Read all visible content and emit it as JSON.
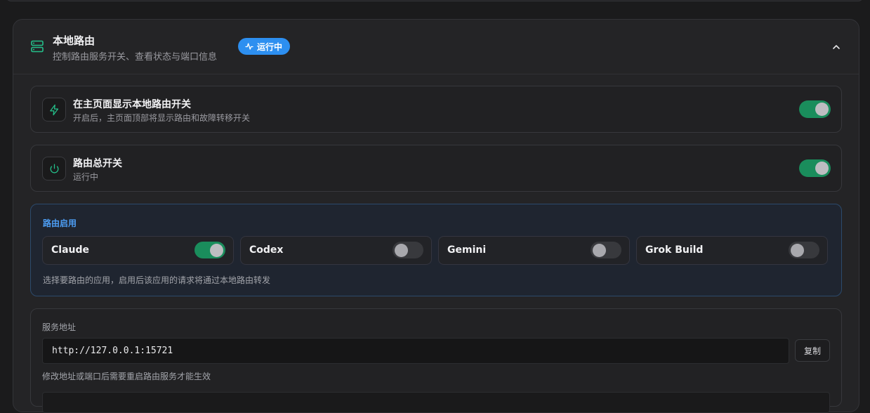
{
  "section": {
    "title": "本地路由",
    "subtitle": "控制路由服务开关、查看状态与端口信息",
    "status_badge": "运行中",
    "collapse_icon": "chevron-up-icon",
    "header_icon": "server-icon"
  },
  "show_on_main": {
    "title": "在主页面显示本地路由开关",
    "subtitle": "开启后，主页面顶部将显示路由和故障转移开关",
    "icon": "lightning-icon",
    "enabled": true
  },
  "master_switch": {
    "title": "路由总开关",
    "subtitle": "运行中",
    "icon": "power-icon",
    "enabled": true
  },
  "routing": {
    "label": "路由启用",
    "apps": [
      {
        "name": "Claude",
        "enabled": true
      },
      {
        "name": "Codex",
        "enabled": false
      },
      {
        "name": "Gemini",
        "enabled": false
      },
      {
        "name": "Grok Build",
        "enabled": false
      }
    ],
    "hint": "选择要路由的应用，启用后该应用的请求将通过本地路由转发"
  },
  "service": {
    "label": "服务地址",
    "address": "http://127.0.0.1:15721",
    "copy_label": "复制",
    "hint": "修改地址或端口后需要重启路由服务才能生效"
  },
  "colors": {
    "accent_green": "#1a8d5c",
    "accent_blue": "#2d8ff0",
    "route_label": "#4d9ef5"
  }
}
